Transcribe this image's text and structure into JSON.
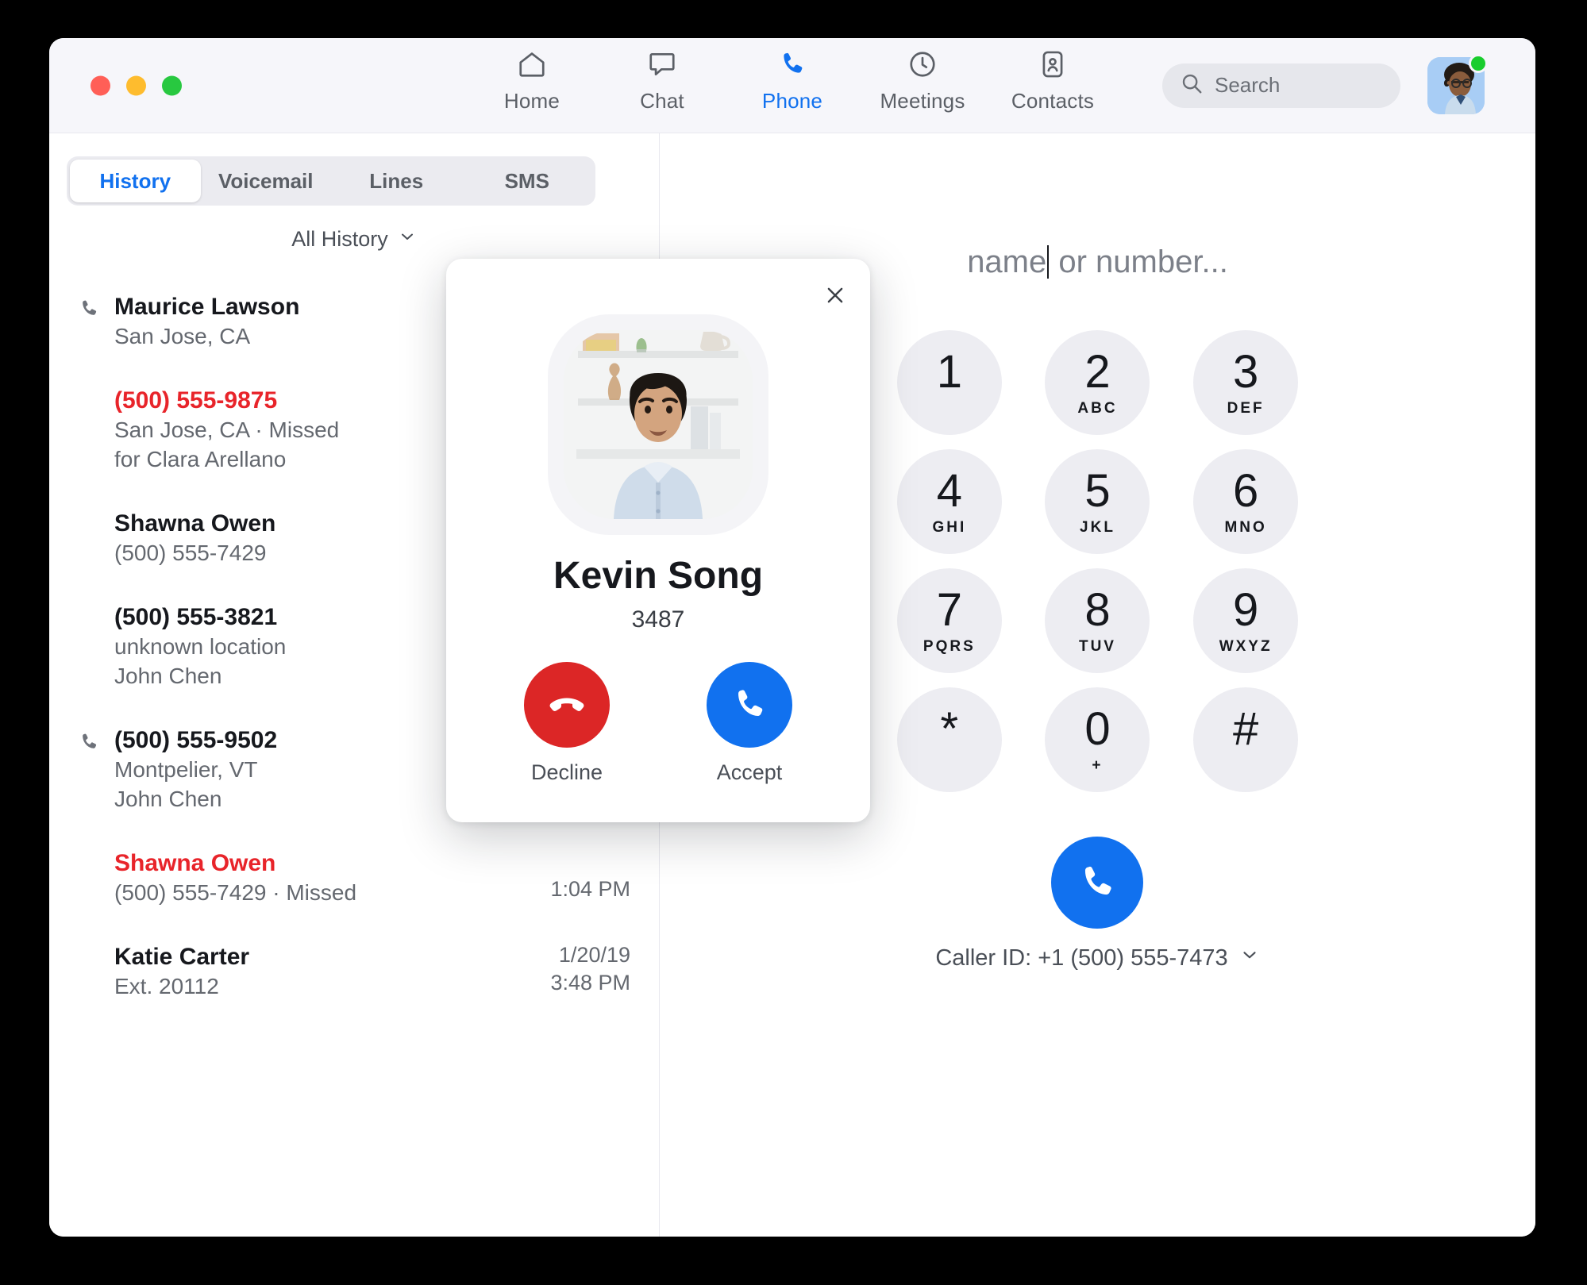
{
  "window": {
    "traffic_lights": [
      "close",
      "minimize",
      "maximize"
    ]
  },
  "nav": {
    "items": [
      {
        "label": "Home",
        "icon": "home-icon",
        "active": false
      },
      {
        "label": "Chat",
        "icon": "chat-icon",
        "active": false
      },
      {
        "label": "Phone",
        "icon": "phone-icon",
        "active": true
      },
      {
        "label": "Meetings",
        "icon": "clock-icon",
        "active": false
      },
      {
        "label": "Contacts",
        "icon": "contacts-icon",
        "active": false
      }
    ],
    "search": {
      "placeholder": "Search",
      "value": "",
      "icon": "search-icon"
    },
    "avatar": {
      "name": "user-avatar",
      "presence": "available",
      "presence_color": "#19cd2d"
    }
  },
  "left_pane": {
    "tabs": [
      {
        "label": "History",
        "active": true
      },
      {
        "label": "Voicemail",
        "active": false
      },
      {
        "label": "Lines",
        "active": false
      },
      {
        "label": "SMS",
        "active": false
      }
    ],
    "filter": {
      "label": "All History",
      "chevron": "chevron-down-icon"
    },
    "calls": [
      {
        "title": "Maurice Lawson",
        "missed": false,
        "has_phone_icon": true,
        "lines": [
          "San Jose, CA"
        ],
        "time": [
          "",
          ""
        ]
      },
      {
        "title": "(500) 555-9875",
        "missed": true,
        "has_phone_icon": false,
        "lines": [
          "San Jose, CA · Missed",
          "for Clara Arellano"
        ],
        "time": [
          "",
          ""
        ]
      },
      {
        "title": "Shawna Owen",
        "missed": false,
        "has_phone_icon": false,
        "lines": [
          "(500) 555-7429"
        ],
        "time": [
          "",
          ""
        ]
      },
      {
        "title": "(500) 555-3821",
        "missed": false,
        "has_phone_icon": false,
        "lines": [
          "unknown location",
          "John Chen"
        ],
        "time": [
          "",
          ""
        ]
      },
      {
        "title": "(500) 555-9502",
        "missed": false,
        "has_phone_icon": true,
        "lines": [
          "Montpelier, VT",
          "John Chen"
        ],
        "time": [
          "",
          ""
        ]
      },
      {
        "title": "Shawna Owen",
        "missed": true,
        "has_phone_icon": false,
        "lines": [
          "(500) 555-7429 · Missed"
        ],
        "time": [
          "",
          "1:04 PM"
        ]
      },
      {
        "title": "Katie Carter",
        "missed": false,
        "has_phone_icon": false,
        "lines": [
          "Ext. 20112"
        ],
        "time": [
          "1/20/19",
          "3:48 PM"
        ]
      }
    ]
  },
  "right_pane": {
    "dial_input": {
      "placeholder": "Enter a name or number...",
      "visible_text": "name",
      "trailing_text": " or number...",
      "caret": true
    },
    "keys": [
      {
        "digit": "1",
        "letters": ""
      },
      {
        "digit": "2",
        "letters": "ABC"
      },
      {
        "digit": "3",
        "letters": "DEF"
      },
      {
        "digit": "4",
        "letters": "GHI"
      },
      {
        "digit": "5",
        "letters": "JKL"
      },
      {
        "digit": "6",
        "letters": "MNO"
      },
      {
        "digit": "7",
        "letters": "PQRS"
      },
      {
        "digit": "8",
        "letters": "TUV"
      },
      {
        "digit": "9",
        "letters": "WXYZ"
      },
      {
        "digit": "*",
        "letters": ""
      },
      {
        "digit": "0",
        "letters": "+"
      },
      {
        "digit": "#",
        "letters": ""
      }
    ],
    "call_button": {
      "name": "call-button",
      "color": "#1171ef",
      "icon": "phone-icon"
    },
    "caller_id": {
      "label": "Caller ID: +1 (500) 555-7473",
      "chevron": "chevron-down-icon"
    }
  },
  "incoming_call": {
    "caller_name": "Kevin Song",
    "caller_extension": "3487",
    "close_icon": "close-icon",
    "decline": {
      "label": "Decline",
      "color": "#dc2626",
      "icon": "phone-down-icon"
    },
    "accept": {
      "label": "Accept",
      "color": "#1171ef",
      "icon": "phone-icon"
    }
  },
  "colors": {
    "accent_blue": "#1171ef",
    "missed_red": "#e8242a",
    "decline_red": "#dc2626",
    "titlebar_bg": "#f6f6fa",
    "key_bg": "#ededf2"
  }
}
